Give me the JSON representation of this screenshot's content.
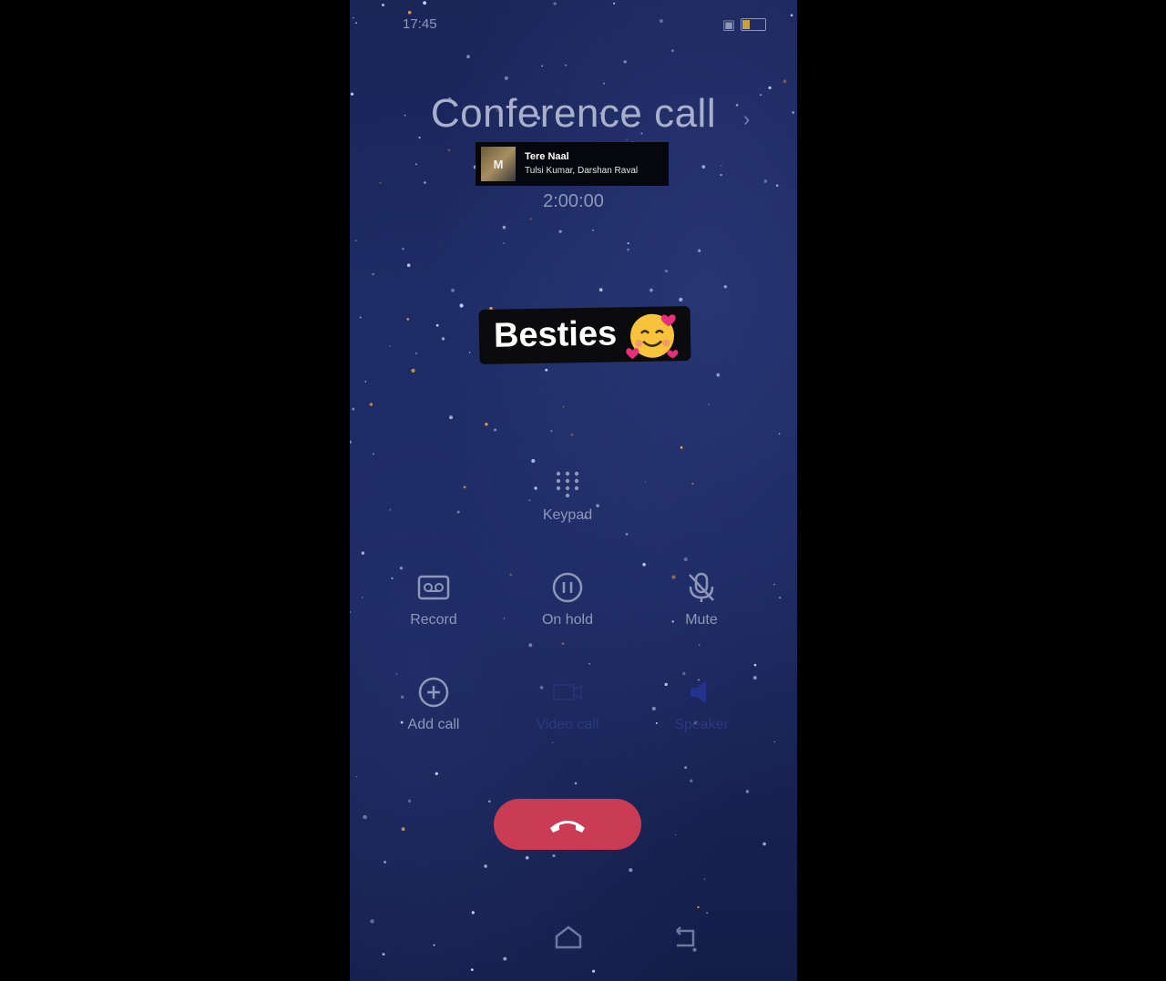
{
  "status": {
    "time": "17:45"
  },
  "call": {
    "title": "Conference call",
    "duration": "2:00:00"
  },
  "music": {
    "song": "Tere Naal",
    "artist": "Tulsi Kumar, Darshan Raval"
  },
  "sticker": {
    "text": "Besties"
  },
  "controls": {
    "keypad": "Keypad",
    "record": "Record",
    "hold": "On hold",
    "mute": "Mute",
    "add_call": "Add call",
    "video_call": "Video call",
    "speaker": "Speaker"
  },
  "colors": {
    "background": "#1c2a62",
    "text": "#8e97b8",
    "end_call": "#c93c54",
    "disabled": "#2a3a80"
  }
}
